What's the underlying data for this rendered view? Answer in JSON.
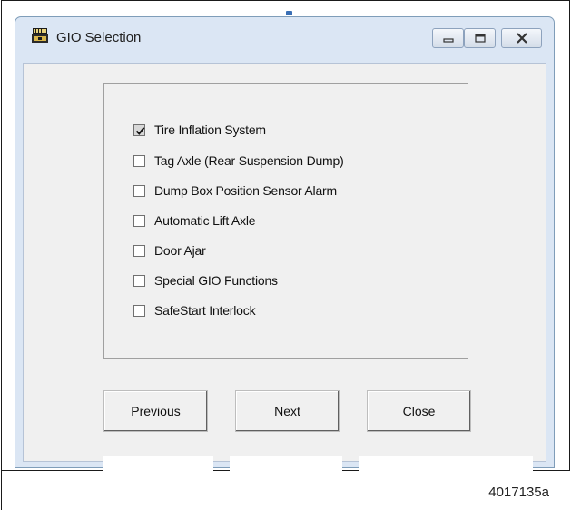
{
  "window": {
    "title": "GIO Selection",
    "icon": "app-icon",
    "controls": [
      "minimize-icon",
      "maximize-icon",
      "close-icon"
    ]
  },
  "options": [
    {
      "label": "Tire Inflation System",
      "checked": true
    },
    {
      "label": "Tag Axle (Rear Suspension Dump)",
      "checked": false
    },
    {
      "label": "Dump Box Position Sensor Alarm",
      "checked": false
    },
    {
      "label": "Automatic Lift Axle",
      "checked": false
    },
    {
      "label": "Door Ajar",
      "checked": false
    },
    {
      "label": "Special GIO Functions",
      "checked": false
    },
    {
      "label": "SafeStart Interlock",
      "checked": false
    }
  ],
  "buttons": {
    "previous": {
      "accel": "P",
      "rest": "revious"
    },
    "next": {
      "accel": "N",
      "rest": "ext"
    },
    "close": {
      "accel": "C",
      "rest": "lose"
    }
  },
  "figure_id": "4017135a"
}
